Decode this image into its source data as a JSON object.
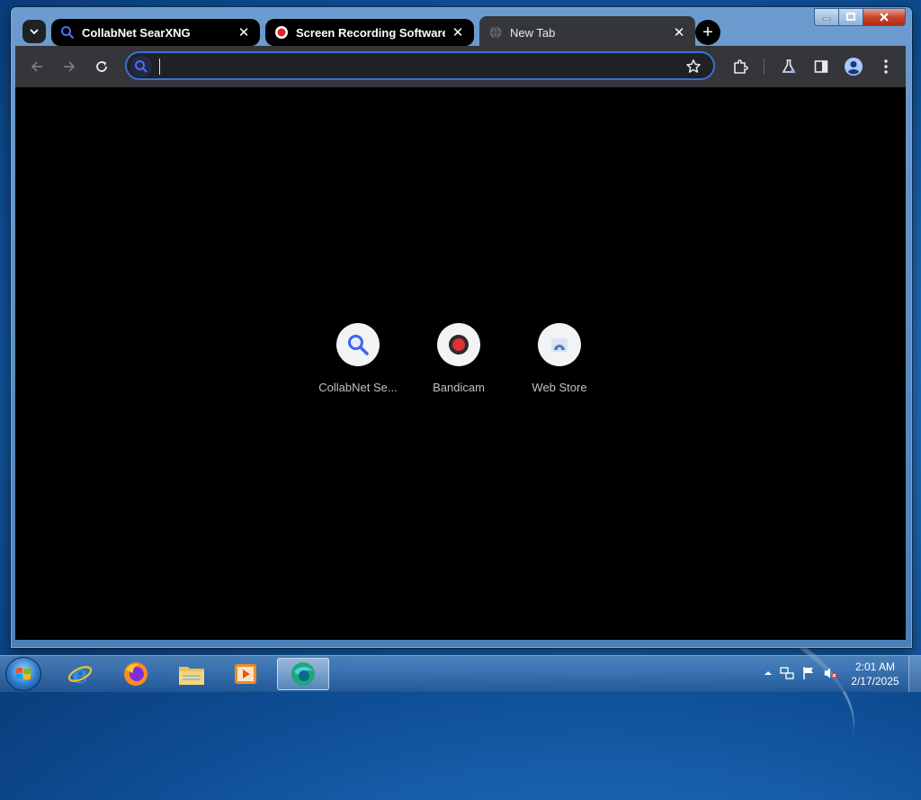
{
  "browser": {
    "tabs": [
      {
        "title": "CollabNet SearXNG",
        "favicon": "magnifier-icon",
        "state": "inactive"
      },
      {
        "title": "Screen Recording Software: ca",
        "favicon": "record-icon",
        "state": "inactive"
      },
      {
        "title": "New Tab",
        "favicon": "globe-icon",
        "state": "active"
      }
    ],
    "omnibox": {
      "value": "",
      "placeholder": ""
    },
    "shortcuts": [
      {
        "label": "CollabNet Se...",
        "icon": "magnifier-icon"
      },
      {
        "label": "Bandicam",
        "icon": "record-icon"
      },
      {
        "label": "Web Store",
        "icon": "web-store-icon"
      }
    ],
    "accent": "#3b6fd6"
  },
  "taskbar": {
    "apps": [
      "internet-explorer-icon",
      "firefox-icon",
      "file-explorer-icon",
      "media-player-icon",
      "browser-icon"
    ],
    "clock": {
      "time": "2:01 AM",
      "date": "2/17/2025"
    }
  }
}
